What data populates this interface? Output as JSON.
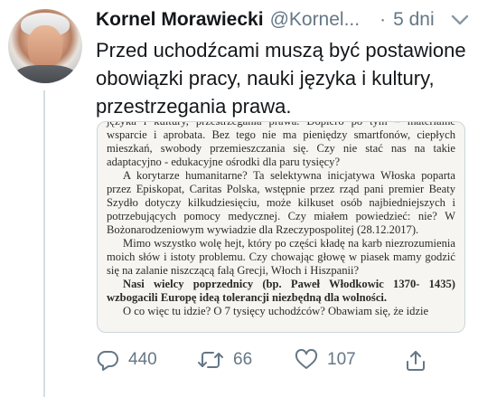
{
  "tweet": {
    "author_name": "Kornel Morawiecki",
    "handle": "@Kornel...",
    "time_sep": "·",
    "time": "5 dni",
    "text": "Przed uchodźcami muszą być postawione obowiązki pracy, nauki języka i kultury, przestrzegania prawa."
  },
  "document": {
    "paragraphs": [
      {
        "text": "języka i kultury, przestrzegania prawa. Dopiero po tym – materialne wsparcie i aprobata. Bez tego nie ma pieniędzy smartfonów, ciepłych mieszkań, swobody przemieszczania się. Czy nie stać nas na takie adaptacyjno - edukacyjne ośrodki dla paru tysięcy?",
        "bold": false,
        "noindent": true
      },
      {
        "text": "A korytarze humanitarne? Ta selektywna inicjatywa Włoska poparta przez Episkopat, Caritas Polska, wstępnie przez rząd pani premier Beaty Szydło dotyczy kilkudziesięciu, może kilkuset osób najbiedniejszych i potrzebujących pomocy medycznej. Czy miałem powiedzieć: nie? W Bożonarodzeniowym wywiadzie dla Rzeczypospolitej (28.12.2017).",
        "bold": false,
        "noindent": false
      },
      {
        "text": "Mimo wszystko wolę hejt, który po części kładę na karb niezrozumienia moich słów i istoty problemu. Czy chowając głowę w piasek mamy godzić się na zalanie niszczącą falą Grecji, Włoch i Hiszpanii?",
        "bold": false,
        "noindent": false
      },
      {
        "text": "Nasi wielcy poprzednicy (bp. Paweł Włodkowic 1370- 1435) wzbogacili Europę ideą tolerancji niezbędną dla wolności.",
        "bold": true,
        "noindent": false
      },
      {
        "text": "O co więc tu idzie? O 7 tysięcy uchodźców? Obawiam się, że idzie",
        "bold": false,
        "noindent": false
      }
    ]
  },
  "actions": {
    "reply_count": "440",
    "retweet_count": "66",
    "like_count": "107"
  },
  "colors": {
    "text": "#14171a",
    "secondary": "#657786",
    "border": "#ccd6dd"
  }
}
